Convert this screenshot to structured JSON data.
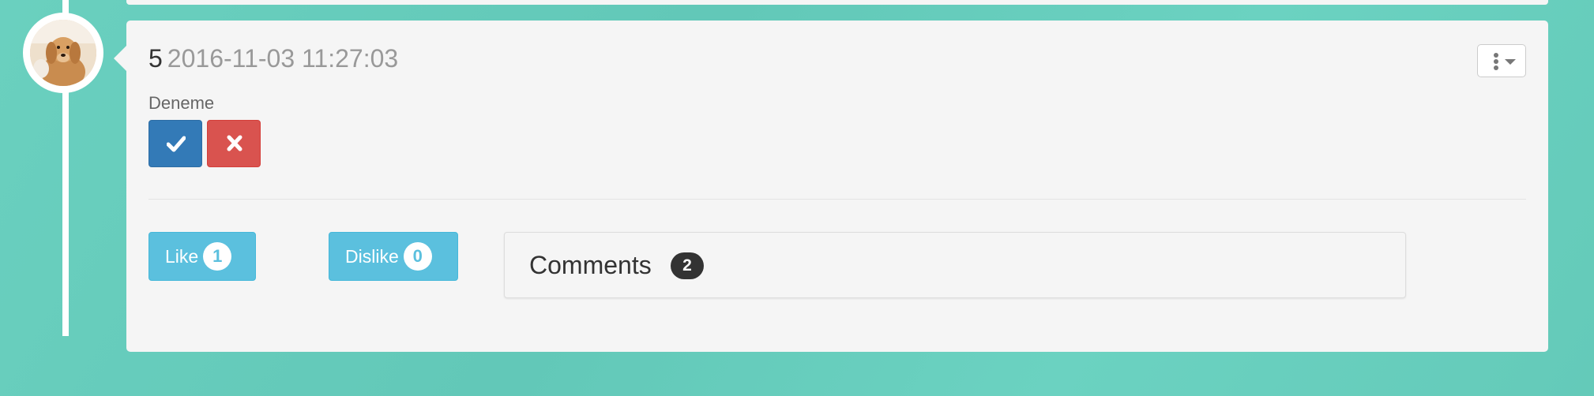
{
  "post": {
    "number": "5",
    "timestamp": "2016-11-03 11:27:03",
    "text": "Deneme",
    "avatar": "dog-avatar",
    "menu_icons": [
      "vertical-dots-icon",
      "caret-down-icon"
    ],
    "approve_icon": "checkmark-icon",
    "reject_icon": "cross-icon"
  },
  "votes": {
    "like_label": "Like",
    "like_count": "1",
    "dislike_label": "Dislike",
    "dislike_count": "0"
  },
  "comments": {
    "title": "Comments",
    "count": "2"
  },
  "colors": {
    "background": "#66ccbb",
    "card": "#f5f5f5",
    "approve": "#337ab7",
    "reject": "#d9534f",
    "vote": "#5bc0de",
    "badge_dark": "#333333"
  }
}
